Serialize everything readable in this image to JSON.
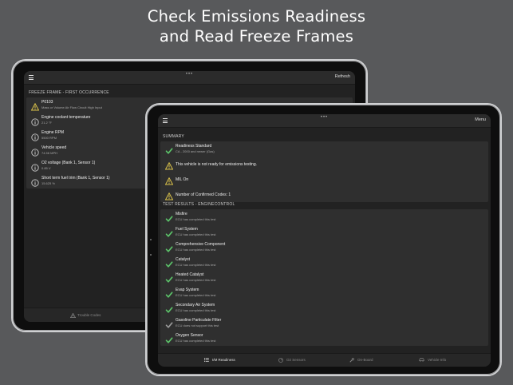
{
  "headline": {
    "line1": "Check Emissions Readiness",
    "line2": "and Read Freeze Frames"
  },
  "back_tablet": {
    "status_dots": "•••",
    "nav_right": "Refresh",
    "section": "FREEZE FRAME - FIRST OCCURRENCE",
    "rows": [
      {
        "title": "P0103",
        "sub": "Mass or Volume Air Flow Circuit High Input",
        "icon": "warning-icon"
      },
      {
        "title": "Engine coolant temperature",
        "sub": "21.2 °F",
        "icon": "info-icon"
      },
      {
        "title": "Engine RPM",
        "sub": "5500 RPM",
        "icon": "info-icon"
      },
      {
        "title": "Vehicle speed",
        "sub": "74.56 MPH",
        "icon": "info-icon"
      },
      {
        "title": "O2 voltage (Bank 1, Sensor 1)",
        "sub": "0.85 V",
        "icon": "info-icon"
      },
      {
        "title": "Short term fuel trim (Bank 1, Sensor 1)",
        "sub": "15.625 %",
        "icon": "info-icon"
      }
    ],
    "tab_label": "Trouble Codes"
  },
  "front_tablet": {
    "status_dots": "•••",
    "nav_right": "Menu",
    "summary_header": "SUMMARY",
    "summary_rows": [
      {
        "title": "Readiness Standard",
        "sub": "CA - 2000 and newer (Gas)",
        "icon": "check-icon"
      },
      {
        "title": "This vehicle is not ready for emissions testing.",
        "sub": "",
        "icon": "warning-icon"
      },
      {
        "title": "MIL On",
        "sub": "",
        "icon": "warning-icon"
      },
      {
        "title": "Number of Confirmed Codes: 1",
        "sub": "",
        "icon": "warning-icon"
      }
    ],
    "tests_header": "TEST RESULTS - ENGINECONTROL",
    "test_rows": [
      {
        "title": "Misfire",
        "sub": "ECU has completed this test",
        "icon": "check-icon"
      },
      {
        "title": "Fuel System",
        "sub": "ECU has completed this test",
        "icon": "check-icon"
      },
      {
        "title": "Comprehensive Component",
        "sub": "ECU has completed this test",
        "icon": "check-icon"
      },
      {
        "title": "Catalyst",
        "sub": "ECU has completed this test",
        "icon": "check-icon"
      },
      {
        "title": "Heated Catalyst",
        "sub": "ECU has completed this test",
        "icon": "check-icon"
      },
      {
        "title": "Evap System",
        "sub": "ECU has completed this test",
        "icon": "check-icon"
      },
      {
        "title": "Secondary Air System",
        "sub": "ECU has completed this test",
        "icon": "check-icon"
      },
      {
        "title": "Gasoline Particulate Filter",
        "sub": "ECU does not support this test",
        "icon": "check-icon-muted"
      },
      {
        "title": "Oxygen Sensor",
        "sub": "ECU has completed this test",
        "icon": "check-icon"
      }
    ],
    "tabs": [
      {
        "label": "I/M Readiness",
        "icon": "list-icon",
        "active": true
      },
      {
        "label": "O2 Sensors",
        "icon": "gauge-icon",
        "active": false
      },
      {
        "label": "On-Board",
        "icon": "wrench-icon",
        "active": false
      },
      {
        "label": "Vehicle Info",
        "icon": "car-icon",
        "active": false
      }
    ]
  },
  "colors": {
    "check": "#5cc46a",
    "warning": "#d9c14a",
    "info": "#c9c9c9",
    "background": "#58595b"
  }
}
